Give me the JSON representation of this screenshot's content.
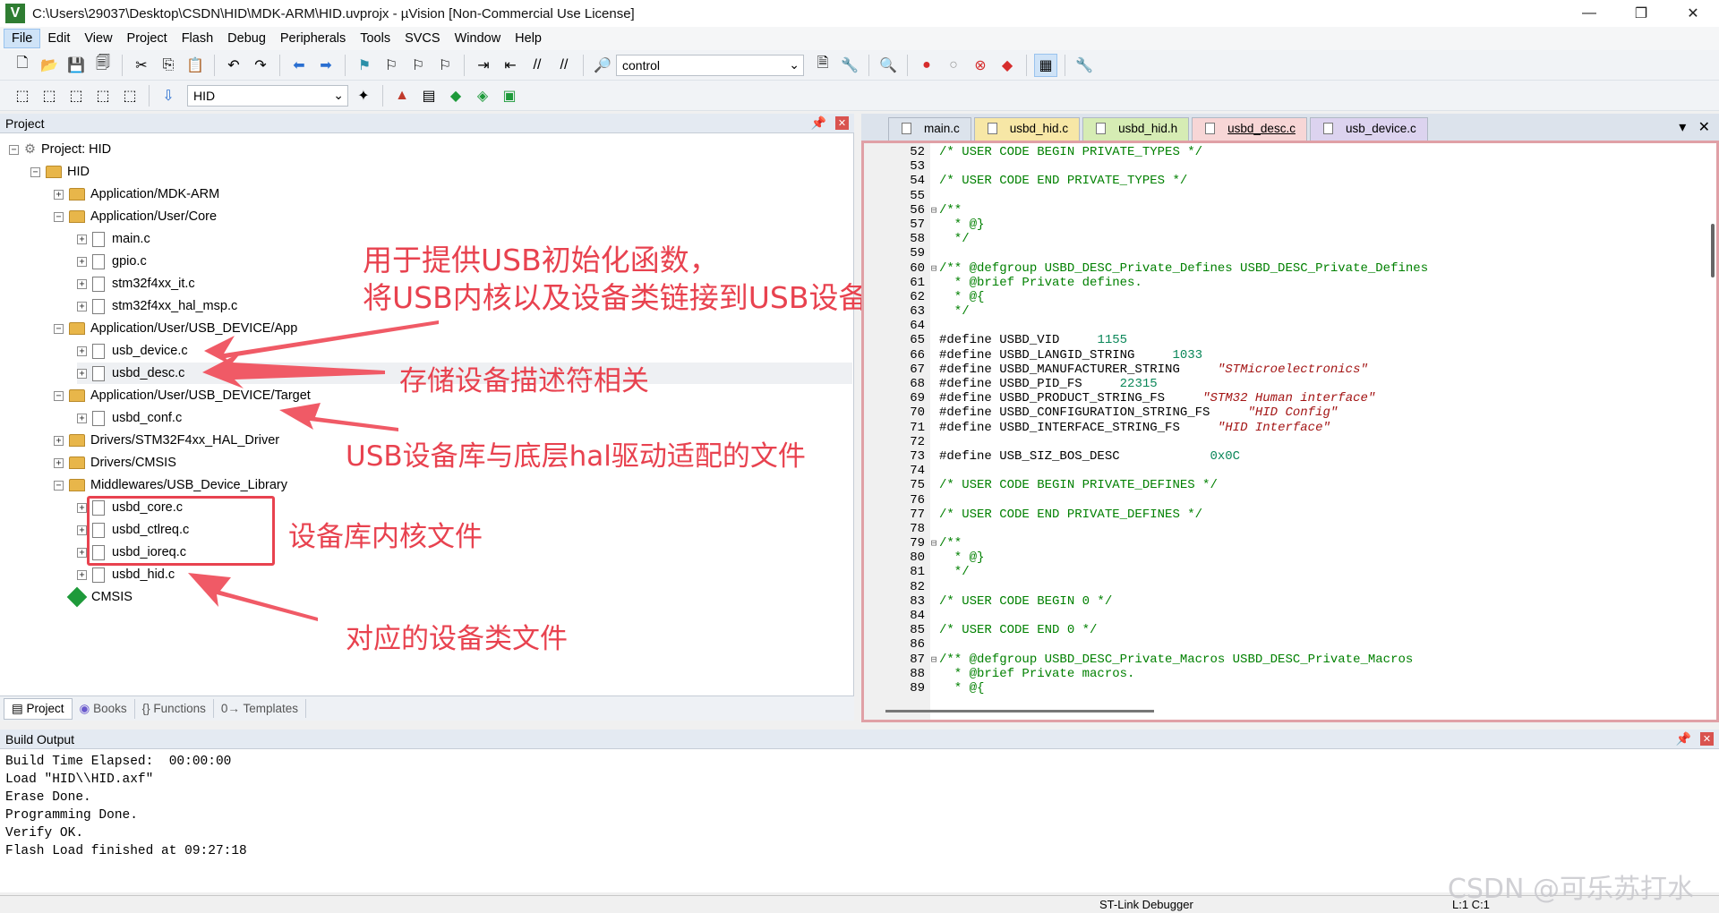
{
  "window": {
    "title": "C:\\Users\\29037\\Desktop\\CSDN\\HID\\MDK-ARM\\HID.uvprojx - µVision  [Non-Commercial Use License]",
    "app_icon": "V"
  },
  "menu": [
    "File",
    "Edit",
    "View",
    "Project",
    "Flash",
    "Debug",
    "Peripherals",
    "Tools",
    "SVCS",
    "Window",
    "Help"
  ],
  "toolbar": {
    "find_combo": "control",
    "target_combo": "HID"
  },
  "project_panel": {
    "title": "Project"
  },
  "tree": [
    {
      "label": "Project: HID",
      "type": "root"
    },
    {
      "label": "HID",
      "type": "target"
    },
    {
      "label": "Application/MDK-ARM",
      "type": "folder"
    },
    {
      "label": "Application/User/Core",
      "type": "folder"
    },
    {
      "label": "main.c",
      "type": "file"
    },
    {
      "label": "gpio.c",
      "type": "file"
    },
    {
      "label": "stm32f4xx_it.c",
      "type": "file"
    },
    {
      "label": "stm32f4xx_hal_msp.c",
      "type": "file"
    },
    {
      "label": "Application/User/USB_DEVICE/App",
      "type": "folder"
    },
    {
      "label": "usb_device.c",
      "type": "file"
    },
    {
      "label": "usbd_desc.c",
      "type": "file"
    },
    {
      "label": "Application/User/USB_DEVICE/Target",
      "type": "folder"
    },
    {
      "label": "usbd_conf.c",
      "type": "file"
    },
    {
      "label": "Drivers/STM32F4xx_HAL_Driver",
      "type": "folder"
    },
    {
      "label": "Drivers/CMSIS",
      "type": "folder"
    },
    {
      "label": "Middlewares/USB_Device_Library",
      "type": "folder"
    },
    {
      "label": "usbd_core.c",
      "type": "file"
    },
    {
      "label": "usbd_ctlreq.c",
      "type": "file"
    },
    {
      "label": "usbd_ioreq.c",
      "type": "file"
    },
    {
      "label": "usbd_hid.c",
      "type": "file"
    },
    {
      "label": "CMSIS",
      "type": "component"
    }
  ],
  "panel_tabs": [
    "Project",
    "Books",
    "Functions",
    "Templates"
  ],
  "editor_tabs": [
    {
      "label": "main.c",
      "color": "#dce3ec"
    },
    {
      "label": "usbd_hid.c",
      "color": "#f7e7a6"
    },
    {
      "label": "usbd_hid.h",
      "color": "#d6ecb4"
    },
    {
      "label": "usbd_desc.c",
      "color": "#f7d6d6"
    },
    {
      "label": "usb_device.c",
      "color": "#dcd3ef"
    }
  ],
  "code": [
    {
      "n": "52",
      "t": "/* USER CODE BEGIN PRIVATE_TYPES */",
      "k": "com"
    },
    {
      "n": "53",
      "t": "",
      "k": ""
    },
    {
      "n": "54",
      "t": "/* USER CODE END PRIVATE_TYPES */",
      "k": "com"
    },
    {
      "n": "55",
      "t": "",
      "k": ""
    },
    {
      "n": "56",
      "t": "/**",
      "k": "com",
      "f": "⊟"
    },
    {
      "n": "57",
      "t": "  * @}",
      "k": "com"
    },
    {
      "n": "58",
      "t": "  */",
      "k": "com"
    },
    {
      "n": "59",
      "t": "",
      "k": ""
    },
    {
      "n": "60",
      "t": "/** @defgroup USBD_DESC_Private_Defines USBD_DESC_Private_Defines",
      "k": "com",
      "f": "⊟"
    },
    {
      "n": "61",
      "t": "  * @brief Private defines.",
      "k": "com"
    },
    {
      "n": "62",
      "t": "  * @{",
      "k": "com"
    },
    {
      "n": "63",
      "t": "  */",
      "k": "com"
    },
    {
      "n": "64",
      "t": "",
      "k": ""
    },
    {
      "n": "65",
      "t": "#define USBD_VID     ",
      "v": "1155",
      "k": "def",
      "vk": "num"
    },
    {
      "n": "66",
      "t": "#define USBD_LANGID_STRING     ",
      "v": "1033",
      "k": "def",
      "vk": "num"
    },
    {
      "n": "67",
      "t": "#define USBD_MANUFACTURER_STRING     ",
      "v": "\"STMicroelectronics\"",
      "k": "def",
      "vk": "str"
    },
    {
      "n": "68",
      "t": "#define USBD_PID_FS     ",
      "v": "22315",
      "k": "def",
      "vk": "num"
    },
    {
      "n": "69",
      "t": "#define USBD_PRODUCT_STRING_FS     ",
      "v": "\"STM32 Human interface\"",
      "k": "def",
      "vk": "str"
    },
    {
      "n": "70",
      "t": "#define USBD_CONFIGURATION_STRING_FS     ",
      "v": "\"HID Config\"",
      "k": "def",
      "vk": "str"
    },
    {
      "n": "71",
      "t": "#define USBD_INTERFACE_STRING_FS     ",
      "v": "\"HID Interface\"",
      "k": "def",
      "vk": "str"
    },
    {
      "n": "72",
      "t": "",
      "k": ""
    },
    {
      "n": "73",
      "t": "#define USB_SIZ_BOS_DESC            ",
      "v": "0x0C",
      "k": "def",
      "vk": "num"
    },
    {
      "n": "74",
      "t": "",
      "k": ""
    },
    {
      "n": "75",
      "t": "/* USER CODE BEGIN PRIVATE_DEFINES */",
      "k": "com"
    },
    {
      "n": "76",
      "t": "",
      "k": ""
    },
    {
      "n": "77",
      "t": "/* USER CODE END PRIVATE_DEFINES */",
      "k": "com"
    },
    {
      "n": "78",
      "t": "",
      "k": ""
    },
    {
      "n": "79",
      "t": "/**",
      "k": "com",
      "f": "⊟"
    },
    {
      "n": "80",
      "t": "  * @}",
      "k": "com"
    },
    {
      "n": "81",
      "t": "  */",
      "k": "com"
    },
    {
      "n": "82",
      "t": "",
      "k": ""
    },
    {
      "n": "83",
      "t": "/* USER CODE BEGIN 0 */",
      "k": "com"
    },
    {
      "n": "84",
      "t": "",
      "k": ""
    },
    {
      "n": "85",
      "t": "/* USER CODE END 0 */",
      "k": "com"
    },
    {
      "n": "86",
      "t": "",
      "k": ""
    },
    {
      "n": "87",
      "t": "/** @defgroup USBD_DESC_Private_Macros USBD_DESC_Private_Macros",
      "k": "com",
      "f": "⊟"
    },
    {
      "n": "88",
      "t": "  * @brief Private macros.",
      "k": "com"
    },
    {
      "n": "89",
      "t": "  * @{",
      "k": "com"
    }
  ],
  "build_output": {
    "title": "Build Output",
    "lines": [
      "Build Time Elapsed:  00:00:00",
      "Load \"HID\\\\HID.axf\"",
      "Erase Done.",
      "Programming Done.",
      "Verify OK.",
      "Flash Load finished at 09:27:18"
    ]
  },
  "status_bar": {
    "debugger": "ST-Link Debugger",
    "position": "L:1 C:1"
  },
  "annotations": {
    "a1_line1": "用于提供USB初始化函数，",
    "a1_line2": "将USB内核以及设备类链接到USB设备库",
    "a2": "存储设备描述符相关",
    "a3": "USB设备库与底层hal驱动适配的文件",
    "a4": "设备库内核文件",
    "a5": "对应的设备类文件"
  },
  "watermark": "CSDN @可乐苏打水",
  "colors": {
    "annotation_red": "#e8424f",
    "comment_green": "#008000",
    "keyword_blue": "#0000ff",
    "string_red": "#a31515",
    "number_teal": "#098658"
  }
}
